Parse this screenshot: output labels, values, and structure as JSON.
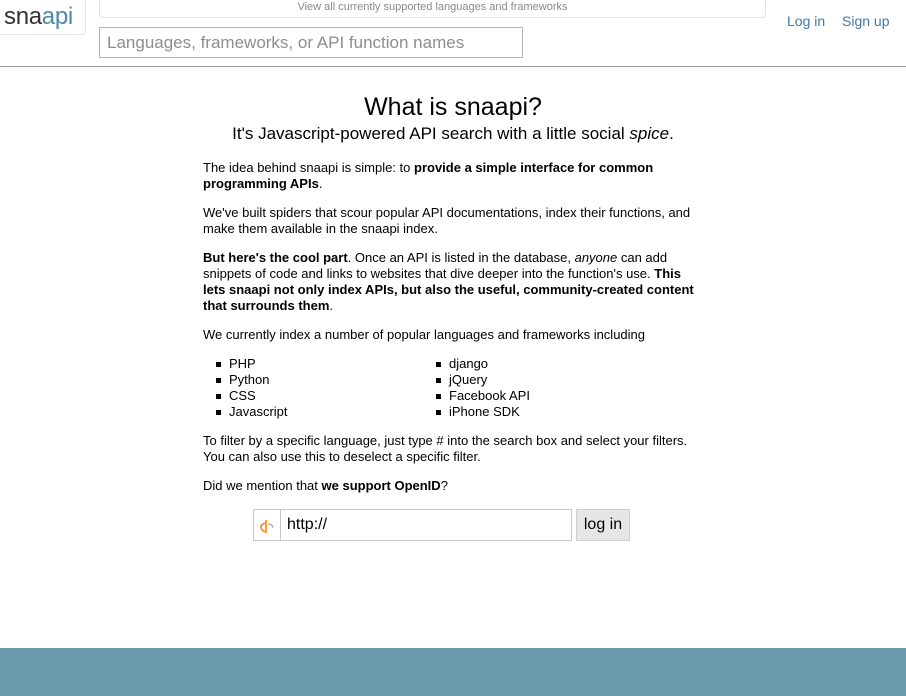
{
  "header": {
    "logo_part1": "sna",
    "logo_part2": "api",
    "languages_link": "View all currently supported languages and frameworks",
    "search_placeholder": "Languages, frameworks, or API function names",
    "nav": {
      "login": "Log in",
      "signup": "Sign up"
    }
  },
  "main": {
    "title": "What is snaapi?",
    "subtitle_prefix": "It's Javascript-powered API search with a little social ",
    "subtitle_em": "spice",
    "subtitle_suffix": ".",
    "p1_prefix": "The idea behind snaapi is simple: to ",
    "p1_bold": "provide a simple interface for common programming APIs",
    "p1_suffix": ".",
    "p2": "We've built spiders that scour popular API documentations, index their functions, and make them available in the snaapi index.",
    "p3_bold1": "But here's the cool part",
    "p3_text1": ". Once an API is listed in the database, ",
    "p3_em": "anyone",
    "p3_text2": " can add snippets of code and links to websites that dive deeper into the function's use. ",
    "p3_bold2": "This lets snaapi not only index APIs, but also the useful, community-created content that surrounds them",
    "p3_suffix": ".",
    "p4": "We currently index a number of popular languages and frameworks including",
    "languages_left": [
      "PHP",
      "Python",
      "CSS",
      "Javascript"
    ],
    "languages_right": [
      "django",
      "jQuery",
      "Facebook API",
      "iPhone SDK"
    ],
    "p5": "To filter by a specific language, just type # into the search box and select your filters. You can also use this to deselect a specific filter.",
    "p6_prefix": "Did we mention that ",
    "p6_bold": "we support OpenID",
    "p6_suffix": "?"
  },
  "openid": {
    "icon": "openid-icon",
    "input_value": "http://",
    "button_label": "log in"
  },
  "colors": {
    "link": "#3f79a3",
    "logo_api": "#4f87ab",
    "footer": "#6a9aac"
  }
}
